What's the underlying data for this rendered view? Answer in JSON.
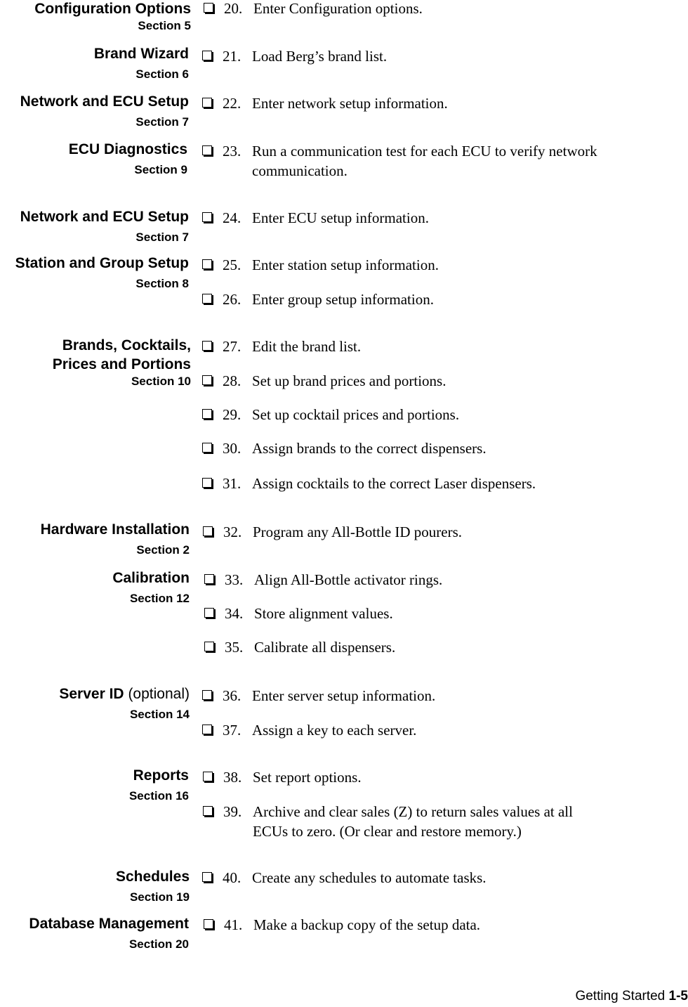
{
  "groups": [
    {
      "title": "Configuration Options",
      "section": "Section 5"
    },
    {
      "title": "Brand Wizard",
      "section": "Section 6"
    },
    {
      "title": "Network and ECU Setup",
      "section": "Section 7"
    },
    {
      "title": "ECU Diagnostics",
      "section": "Section 9"
    },
    {
      "title": "Network and ECU Setup",
      "section": "Section 7"
    },
    {
      "title": "Station and Group Setup",
      "section": "Section 8"
    },
    {
      "title": "Brands, Cocktails,",
      "title2": "Prices and Portions",
      "section": "Section 10"
    },
    {
      "title": "Hardware Installation",
      "section": "Section 2"
    },
    {
      "title": "Calibration",
      "section": "Section 12"
    },
    {
      "title": "Server ID",
      "title_suffix": "(optional)",
      "section": "Section 14"
    },
    {
      "title": "Reports",
      "section": "Section 16"
    },
    {
      "title": "Schedules",
      "section": "Section 19"
    },
    {
      "title": "Database Management",
      "section": "Section 20"
    }
  ],
  "items": [
    {
      "num": "20.",
      "text": "Enter Configuration options."
    },
    {
      "num": "21.",
      "text": "Load Berg’s brand list."
    },
    {
      "num": "22.",
      "text": "Enter network setup information."
    },
    {
      "num": "23.",
      "text": "Run a communication test for each ECU to verify network communication."
    },
    {
      "num": "24.",
      "text": "Enter ECU setup information."
    },
    {
      "num": "25.",
      "text": "Enter station setup information."
    },
    {
      "num": "26.",
      "text": "Enter group setup information."
    },
    {
      "num": "27.",
      "text": "Edit the brand list."
    },
    {
      "num": "28.",
      "text": "Set up brand prices and portions."
    },
    {
      "num": "29.",
      "text": "Set up cocktail prices and portions."
    },
    {
      "num": "30.",
      "text": "Assign brands to the correct dispensers."
    },
    {
      "num": "31.",
      "text": "Assign cocktails to the correct Laser dispensers."
    },
    {
      "num": "32.",
      "text": "Program any All-Bottle ID pourers."
    },
    {
      "num": "33.",
      "text": "Align All-Bottle activator rings."
    },
    {
      "num": "34.",
      "text": "Store alignment values."
    },
    {
      "num": "35.",
      "text": "Calibrate all dispensers."
    },
    {
      "num": "36.",
      "text": "Enter server setup information."
    },
    {
      "num": "37.",
      "text": "Assign a key to each server."
    },
    {
      "num": "38.",
      "text": "Set report options."
    },
    {
      "num": "39.",
      "text": "Archive and clear sales (Z) to return sales values at all ECUs to zero. (Or clear and restore memory.)"
    },
    {
      "num": "40.",
      "text": "Create any schedules to automate tasks."
    },
    {
      "num": "41.",
      "text": "Make a backup copy of the setup data."
    }
  ],
  "footer": {
    "chapter": "Getting Started",
    "page": "1-5"
  }
}
